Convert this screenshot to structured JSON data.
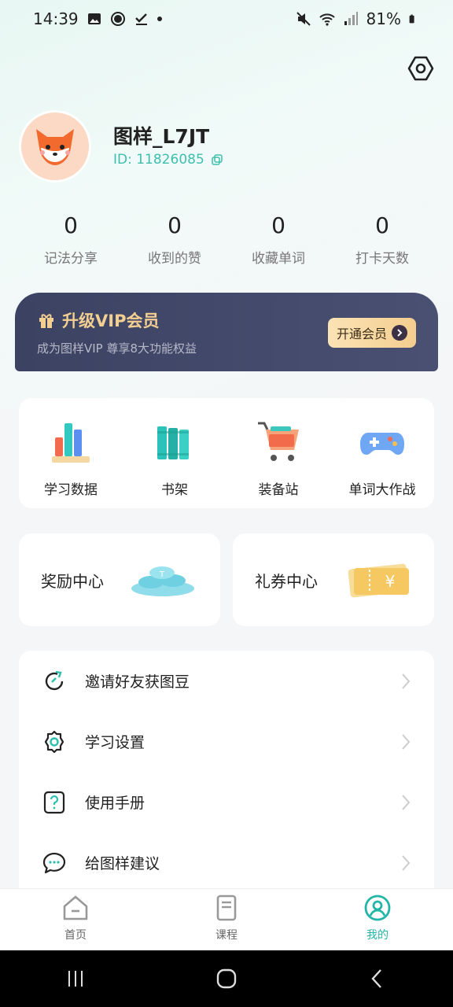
{
  "status_bar": {
    "time": "14:39",
    "battery": "81%"
  },
  "profile": {
    "username": "图样_L7JT",
    "id_text": "ID: 11826085"
  },
  "stats": [
    {
      "value": "0",
      "label": "记法分享"
    },
    {
      "value": "0",
      "label": "收到的赞"
    },
    {
      "value": "0",
      "label": "收藏单词"
    },
    {
      "value": "0",
      "label": "打卡天数"
    }
  ],
  "vip": {
    "title": "升级VIP会员",
    "subtitle": "成为图样VIP  尊享8大功能权益",
    "button": "开通会员"
  },
  "grid": [
    {
      "label": "学习数据",
      "icon": "bar-chart-icon"
    },
    {
      "label": "书架",
      "icon": "books-icon"
    },
    {
      "label": "装备站",
      "icon": "shopping-cart-icon"
    },
    {
      "label": "单词大作战",
      "icon": "gamepad-icon"
    }
  ],
  "centers": {
    "reward": "奖励中心",
    "coupon": "礼券中心"
  },
  "menu": [
    {
      "label": "邀请好友获图豆",
      "icon": "invite-icon"
    },
    {
      "label": "学习设置",
      "icon": "gear-icon"
    },
    {
      "label": "使用手册",
      "icon": "help-icon"
    },
    {
      "label": "给图样建议",
      "icon": "chat-icon"
    }
  ],
  "bottom_nav": [
    {
      "label": "首页",
      "icon": "home-icon"
    },
    {
      "label": "课程",
      "icon": "course-icon"
    },
    {
      "label": "我的",
      "icon": "profile-icon"
    }
  ],
  "colors": {
    "accent": "#23b6a6",
    "vip_gold": "#f4cf92",
    "vip_bg": "#3c4262"
  }
}
